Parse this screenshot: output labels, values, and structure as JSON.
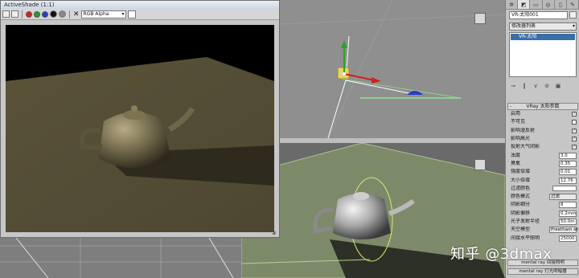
{
  "shade_window": {
    "title": "ActiveShade (1:1)",
    "channel": "RGB Alpha",
    "toolbar_dots": [
      {
        "name": "red-channel-toggle",
        "color": "#d82020"
      },
      {
        "name": "green-channel-toggle",
        "color": "#20a020"
      },
      {
        "name": "blue-channel-toggle",
        "color": "#2040d0"
      },
      {
        "name": "alpha-channel-toggle",
        "color": "#f0f0f0"
      }
    ],
    "clear_icon": "✕"
  },
  "command_panel": {
    "tabs": [
      {
        "name": "create-tab",
        "glyph": "✲"
      },
      {
        "name": "modify-tab",
        "glyph": "◩"
      },
      {
        "name": "hierarchy-tab",
        "glyph": "▭"
      },
      {
        "name": "motion-tab",
        "glyph": "◎"
      },
      {
        "name": "display-tab",
        "glyph": "▯"
      },
      {
        "name": "utilities-tab",
        "glyph": "✎"
      }
    ],
    "object_name": "VR-太阳001",
    "modifier_list": "修改器列表",
    "stack_item": "VR-太阳",
    "rollout_title": "VRay 太阳参数",
    "params": [
      {
        "label": "启用",
        "type": "check",
        "checked": true
      },
      {
        "label": "不可见",
        "type": "check",
        "checked": false
      },
      {
        "label": "影响漫反射",
        "type": "check",
        "checked": true
      },
      {
        "label": "影响高光",
        "type": "check",
        "checked": true
      },
      {
        "label": "投射大气阴影",
        "type": "check",
        "checked": true
      },
      {
        "label": "浊度",
        "type": "spin",
        "value": "3.0"
      },
      {
        "label": "臭氧",
        "type": "spin",
        "value": "0.35"
      },
      {
        "label": "强度倍增",
        "type": "spin",
        "value": "0.01"
      },
      {
        "label": "大小倍增",
        "type": "spin",
        "value": "12.76"
      },
      {
        "label": "过滤颜色",
        "type": "color"
      },
      {
        "label": "颜色模式",
        "type": "dropdown",
        "value": "过滤"
      },
      {
        "label": "阴影细分",
        "type": "spin",
        "value": "8"
      },
      {
        "label": "阴影偏移",
        "type": "spin",
        "value": "0.2mm"
      },
      {
        "label": "光子发射半径",
        "type": "spin",
        "value": "50.0m"
      },
      {
        "label": "天空模型",
        "type": "dropdown",
        "value": "Preetham et"
      },
      {
        "label": "间接水平照明",
        "type": "spin",
        "value": "25000"
      }
    ],
    "bottom_rollouts": [
      "mental ray 间接照明",
      "mental ray 灯光明暗器"
    ]
  },
  "viewports": {
    "cube_top_label": "",
    "cube_bottom_label": ""
  },
  "watermark": "知乎 @3dmax"
}
